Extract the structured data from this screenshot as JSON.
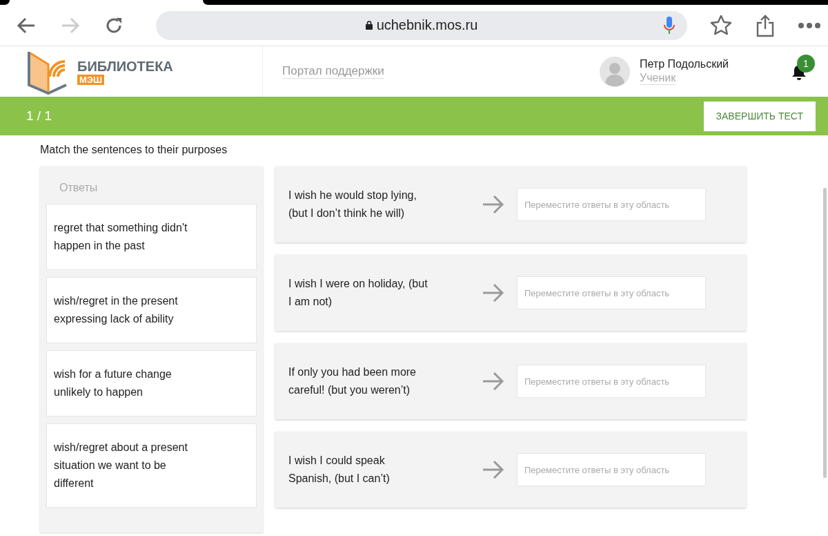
{
  "browser": {
    "url": "uchebnik.mos.ru",
    "back_disabled": false,
    "forward_disabled": true
  },
  "header": {
    "logo_title": "БИБЛИОТЕКА",
    "logo_badge": "МЭШ",
    "support_link": "Портал поддержки",
    "user_name": "Петр Подольский",
    "user_role": "Ученик",
    "notification_count": "1"
  },
  "test_bar": {
    "progress": "1 / 1",
    "finish_button": "ЗАВЕРШИТЬ ТЕСТ"
  },
  "task": {
    "instruction": "Match the sentences to their purposes",
    "answers_title": "Ответы",
    "answers": [
      {
        "lines": [
          "regret that something didn't",
          "happen in the past"
        ]
      },
      {
        "lines": [
          "wish/regret in the present",
          "expressing lack of ability"
        ]
      },
      {
        "lines": [
          "wish for a future change",
          "unlikely to happen"
        ]
      },
      {
        "lines": [
          "wish/regret about a present",
          "situation we want to be",
          "different"
        ]
      }
    ],
    "sentences": [
      {
        "lines": [
          "I wish he would stop lying,",
          "(but I don’t think he will)"
        ],
        "drop_placeholder": "Переместите ответы в эту область"
      },
      {
        "lines": [
          "I wish I were on holiday, (but",
          "I am not)"
        ],
        "drop_placeholder": "Переместите ответы в эту область"
      },
      {
        "lines": [
          "If only you had been more",
          "careful! (but you weren’t)"
        ],
        "drop_placeholder": "Переместите ответы в эту область"
      },
      {
        "lines": [
          "I wish I could speak",
          "Spanish, (but I can’t)"
        ],
        "drop_placeholder": "Переместите ответы в эту область"
      }
    ]
  }
}
